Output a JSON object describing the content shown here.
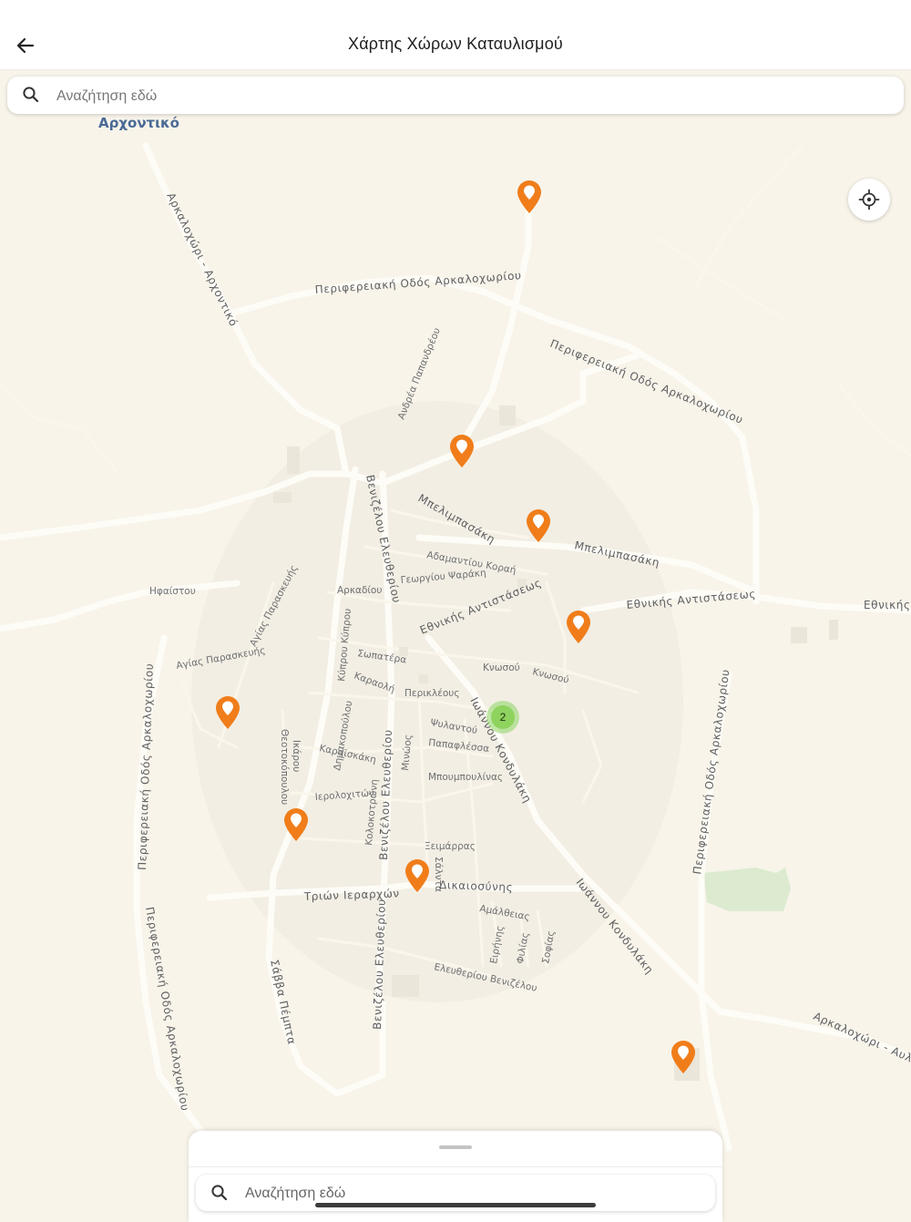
{
  "header": {
    "title": "Χάρτης Χώρων Καταυλισμού"
  },
  "search": {
    "placeholder": "Αναζήτηση εδώ"
  },
  "bottom_sheet": {
    "search_placeholder": "Αναζήτηση εδώ"
  },
  "map": {
    "place_label": "Αρχοντικό",
    "streets": {
      "arkalochori_archontiko": "Αρκαλοχώρι - Αρχοντικό",
      "perif_1": "Περιφερειακή Οδός Αρκαλοχωρίου",
      "perif_2": "Περιφερειακή Οδός Αρκαλοχωρίου",
      "perif_west": "Περιφερειακή Οδός Αρκαλοχωρίου",
      "perif_southwest": "Περιφερειακή Οδός Αρκαλοχωρίου",
      "perif_east": "Περιφερειακή Οδός Αρκαλοχωρίου",
      "andrea_papadopoulou": "Ανδρέα Παπανδρέου",
      "venizelou_1": "Βενιζέλου Ελευθερίου",
      "venizelou_2": "Βενιζέλου Ελευθερίου",
      "venizelou_3": "Βενιζέλου Ελευθερίου",
      "melimpasaki_1": "Μπελιμπασάκη",
      "melimpasaki_2": "Μπελιμπασάκη",
      "adamantiou_korai": "Αδαμαντίου Κοραή",
      "georgiou_psaraki": "Γεωργίου Ψαράκη",
      "arkadiou": "Αρκαδίου",
      "ethnikis_1": "Εθνικής Αντιστάσεως",
      "ethnikis_2": "Εθνικής Αντιστάσεως",
      "ethnikis_3": "Εθνικής",
      "ifaistou": "Ηφαίστου",
      "agias_paraskevis_1": "Αγίας Παρασκευής",
      "agias_paraskevis_2": "Αγίας Παρασκευής",
      "kyprou": "Κύπρου Κύπρου",
      "sopatera": "Σωπατέρα",
      "karaoli": "Καραολή",
      "dimakopoulou": "Δημακοπούλου",
      "knossou_1": "Κνωσού",
      "knossou_2": "Κνωσού",
      "perikleous": "Περικλέους",
      "ioannou_1": "Ιωάννου Κονδυλάκη",
      "ioannou_2": "Ιωάννου Κονδυλάκη",
      "psiloritou": "Ψυλαντού",
      "papaflessa": "Παπαφλέσσα",
      "theotokopoulou": "Θεοτοκόπουλου",
      "ikarou": "Ικάρου",
      "karaiskaki": "Καραϊσκάκη",
      "minoos": "Μινώος",
      "mpoumpoulinas": "Μπουμπουλίνας",
      "ierolochiton": "Ιερολοχιτών",
      "kolokotroni": "Κολοκοτρώνη",
      "xeimarras": "Ξειμάρρας",
      "salonta": "Σάλντα",
      "trion_ierarchon": "Τριών Ιεραρχών",
      "dikaiosynis": "Δικαιοσύνης",
      "amaltheias": "Αμάλθειας",
      "eirinis": "Ειρήνης",
      "filias": "Φιλίας",
      "sofias": "Σοφίας",
      "eleftheriou_venizelou": "Ελευθερίου Βενιζέλου",
      "savva_pempta": "Σάββα Πέμπτα",
      "arkalochori_avli": "Αρκαλοχώρι - Αυλή"
    },
    "cluster": {
      "count": "2"
    },
    "pin_color": "#f07d1a",
    "cluster_color": "#8ed35e"
  },
  "icons": {
    "back": "arrow-left-icon",
    "search": "search-icon",
    "locate": "crosshair-icon",
    "pin": "map-pin-icon"
  }
}
